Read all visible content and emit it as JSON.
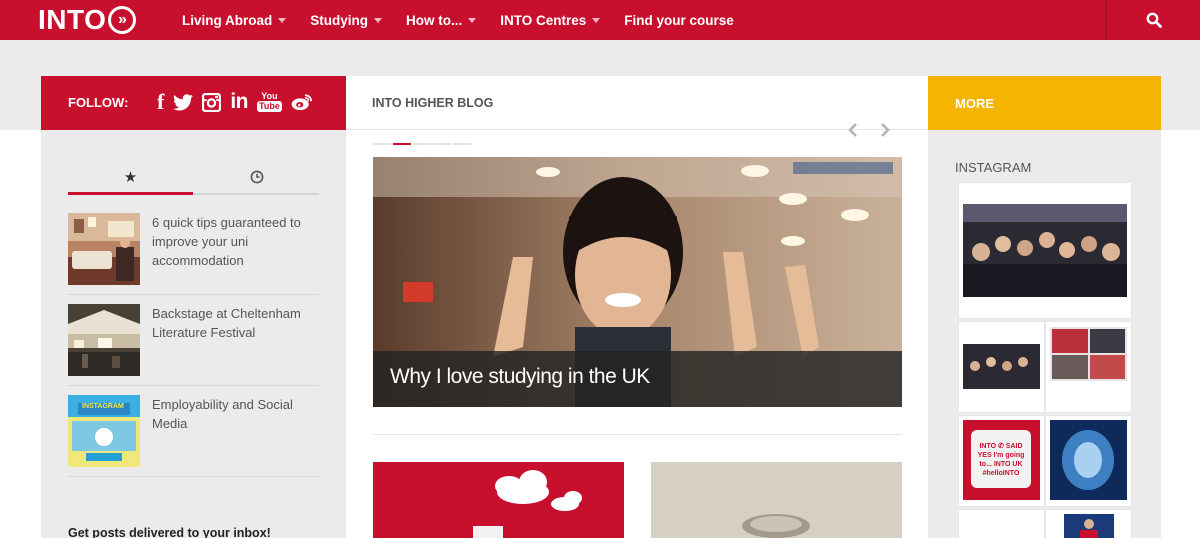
{
  "brand": {
    "logo_text": "INTO",
    "logo_arrow": "»"
  },
  "nav": {
    "items": [
      {
        "label": "Living Abroad",
        "has_dropdown": true
      },
      {
        "label": "Studying",
        "has_dropdown": true
      },
      {
        "label": "How to...",
        "has_dropdown": true
      },
      {
        "label": "INTO Centres",
        "has_dropdown": true
      },
      {
        "label": "Find your course",
        "has_dropdown": false
      }
    ],
    "search_icon": "search-icon"
  },
  "follow": {
    "label": "FOLLOW:",
    "icons": [
      "facebook-icon",
      "twitter-icon",
      "instagram-icon",
      "linkedin-icon",
      "youtube-icon",
      "weibo-icon"
    ],
    "glyphs": {
      "facebook": "f",
      "linkedin": "in",
      "youtube_top": "You",
      "youtube_bottom": "Tube"
    }
  },
  "sidebar": {
    "tabs": [
      {
        "icon": "star-icon",
        "glyph": "★",
        "active": true
      },
      {
        "icon": "clock-icon",
        "glyph": "◷",
        "active": false
      }
    ],
    "posts": [
      {
        "title": "6 quick tips guaranteed to improve your uni accommodation"
      },
      {
        "title": "Backstage at Cheltenham Literature Festival"
      },
      {
        "title": "Employability and Social Media"
      }
    ],
    "thumb3_text": "INSTAGRAM",
    "subscribe_label": "Get posts delivered to your inbox!"
  },
  "blog": {
    "title": "INTO HIGHER BLOG",
    "prev_icon": "chevron-left-icon",
    "next_icon": "chevron-right-icon",
    "slides_count": 5,
    "active_slide": 2,
    "hero_caption": "Why I love studying in the UK"
  },
  "more": {
    "label": "MORE",
    "instagram_label": "INSTAGRAM",
    "tile_caption": "INTO ✆ SAID YES I'm going to... INTO UK #helloINTO"
  },
  "colors": {
    "brand_red": "#c8102e",
    "more_yellow": "#f4b400",
    "background": "#ebebeb"
  }
}
